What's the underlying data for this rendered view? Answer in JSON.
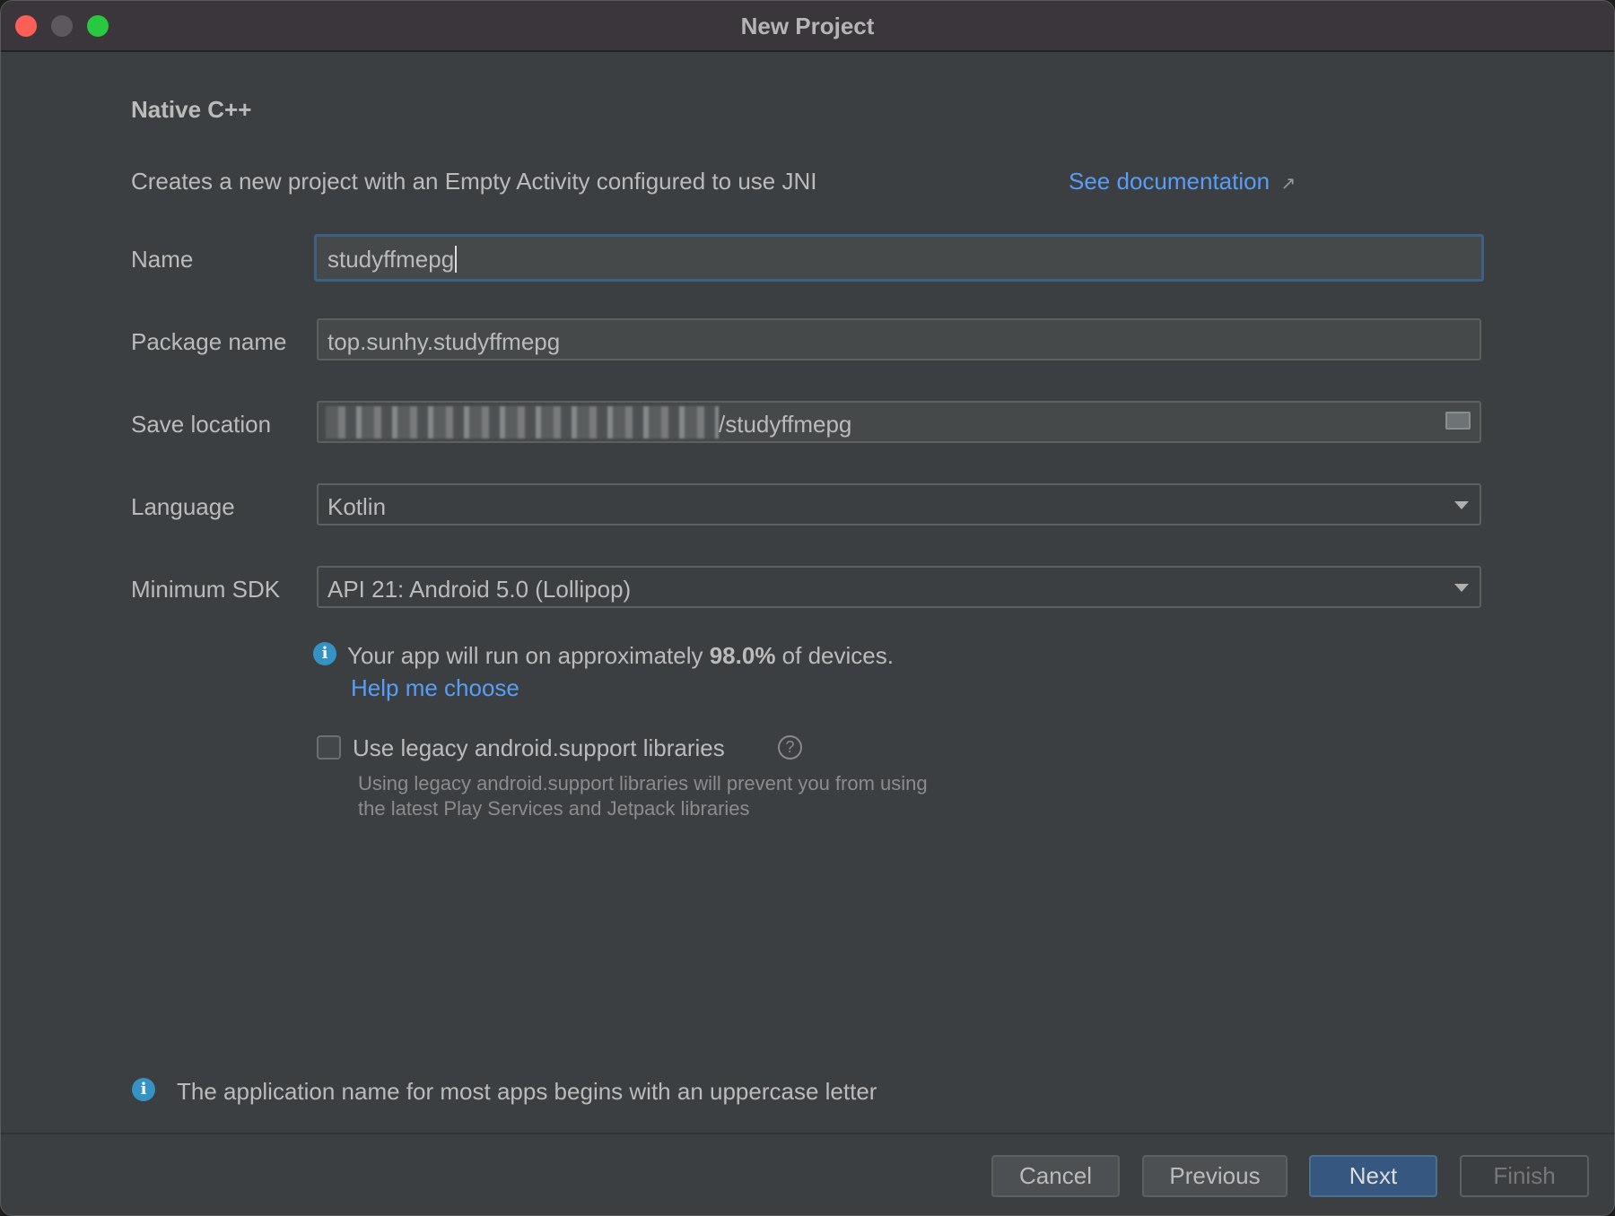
{
  "window": {
    "title": "New Project",
    "controls": {
      "close": "#ff5f57",
      "minimize": "#5d585e",
      "zoom": "#28c840"
    }
  },
  "header": {
    "title": "Native C++",
    "description": "Creates a new project with an Empty Activity configured to use JNI",
    "doc_link": "See documentation",
    "doc_icon": "external-link-arrow"
  },
  "form": {
    "name": {
      "label": "Name",
      "value": "studyffmepg"
    },
    "package": {
      "label": "Package name",
      "value": "top.sunhy.studyffmepg"
    },
    "save_location": {
      "label": "Save location",
      "value": "/studyffmepg",
      "icon": "folder-icon"
    },
    "language": {
      "label": "Language",
      "value": "Kotlin"
    },
    "min_sdk": {
      "label": "Minimum SDK",
      "value": "API 21: Android 5.0 (Lollipop)"
    }
  },
  "sdk_info": {
    "prefix": "Your app will run on approximately ",
    "percent": "98.0%",
    "suffix": " of devices.",
    "help_link": "Help me choose"
  },
  "legacy": {
    "label": "Use legacy android.support libraries",
    "checked": false,
    "desc1": "Using legacy android.support libraries will prevent you from using",
    "desc2": "the latest Play Services and Jetpack libraries"
  },
  "footer_info": "The application name for most apps begins with an uppercase letter",
  "buttons": {
    "cancel": "Cancel",
    "previous": "Previous",
    "next": "Next",
    "finish": "Finish"
  },
  "colors": {
    "accent": "#365880",
    "link": "#589df6",
    "info": "#3592c4"
  }
}
